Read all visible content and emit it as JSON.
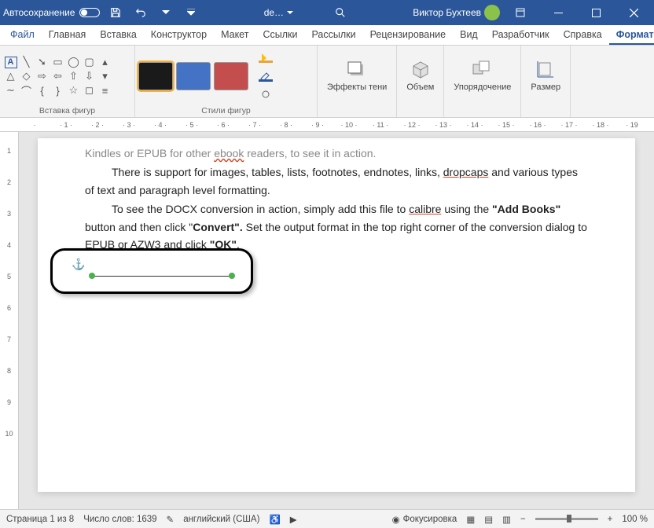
{
  "titlebar": {
    "autosave": "Автосохранение",
    "doc": "de…",
    "user": "Виктор Бухтеев"
  },
  "tabs": {
    "file": "Файл",
    "home": "Главная",
    "insert": "Вставка",
    "design": "Конструктор",
    "layout": "Макет",
    "references": "Ссылки",
    "mailings": "Рассылки",
    "review": "Рецензирование",
    "view": "Вид",
    "developer": "Разработчик",
    "help": "Справка",
    "shapeformat": "Формат фигу"
  },
  "ribbon": {
    "insert_shapes": "Вставка фигур",
    "shape_styles": "Стили фигур",
    "effects": "Эффекты тени",
    "volume": "Объем",
    "arrange": "Упорядочение",
    "size": "Размер",
    "swatch_colors": [
      "#1a1a1a",
      "#4472c4",
      "#c44d4d"
    ]
  },
  "document": {
    "line0": "Kindles or EPUB for other ",
    "line0_err": "ebook",
    "line0_b": " readers, to see it in action.",
    "line1a": "There is support for images, tables, lists, footnotes, endnotes, links, ",
    "line1_link": "dropcaps",
    "line1b": " and various types of text and paragraph level formatting.",
    "line2a": "To see the DOCX conversion in action, simply add this file to ",
    "line2_link": "calibre",
    "line2b": " using the ",
    "addbooks": "\"Add Books\"",
    "line3a": " button and then click \"",
    "convert": "Convert\".",
    "line3b": "  Set the output format in the top right corner of the conversion dialog to EPUB or AZW3 and click ",
    "ok": "\"OK\"",
    "dot": "."
  },
  "status": {
    "page": "Страница 1 из 8",
    "words": "Число слов: 1639",
    "lang": "английский (США)",
    "focus": "Фокусировка",
    "zoom": "100 %"
  }
}
